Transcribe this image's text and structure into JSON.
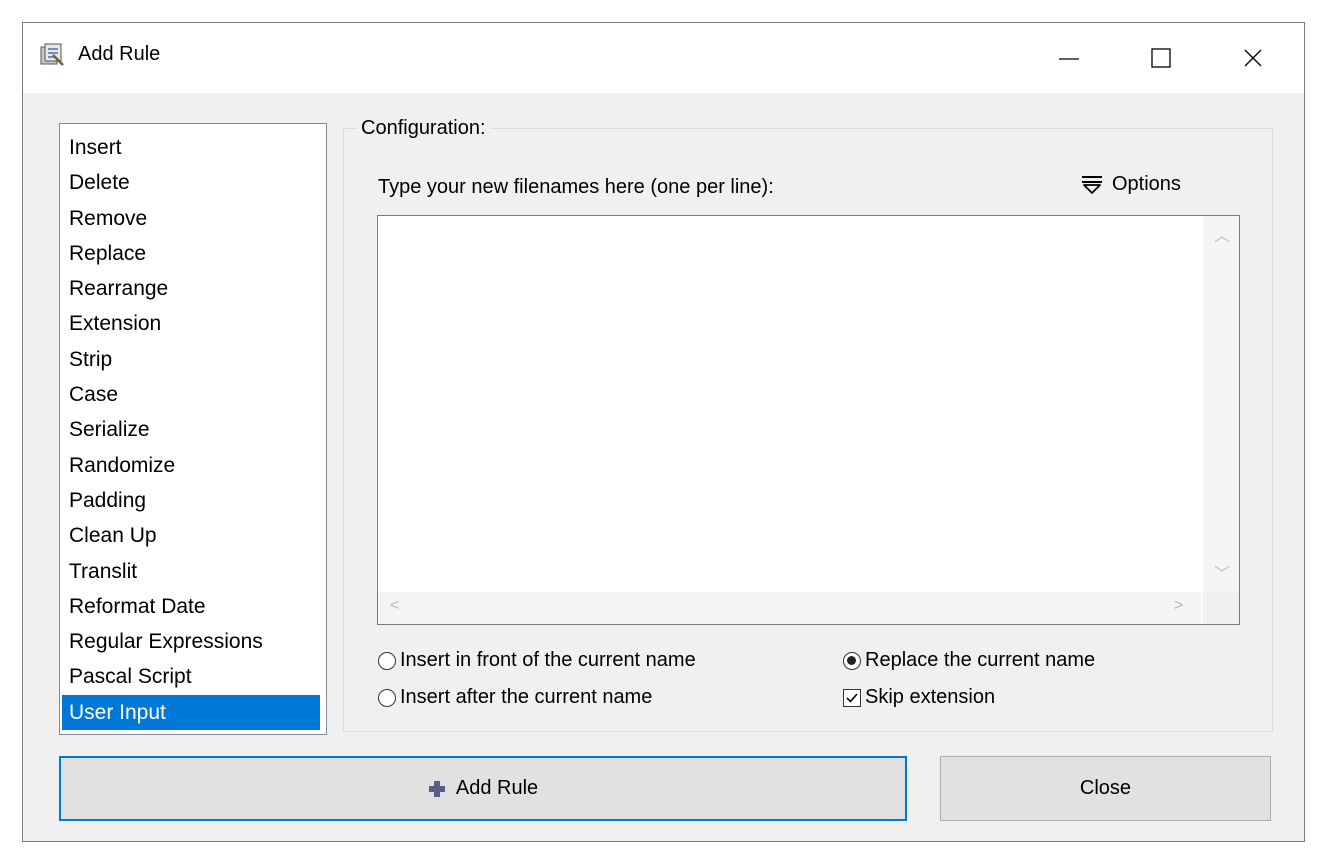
{
  "window": {
    "title": "Add Rule"
  },
  "rules_list": {
    "items": [
      "Insert",
      "Delete",
      "Remove",
      "Replace",
      "Rearrange",
      "Extension",
      "Strip",
      "Case",
      "Serialize",
      "Randomize",
      "Padding",
      "Clean Up",
      "Translit",
      "Reformat Date",
      "Regular Expressions",
      "Pascal Script",
      "User Input"
    ],
    "selected": "User Input"
  },
  "configuration": {
    "legend": "Configuration:",
    "prompt": "Type your new filenames here (one per line):",
    "options_label": "Options",
    "text_value": "",
    "radio_insert_front": "Insert in front of the current name",
    "radio_insert_after": "Insert after the current name",
    "radio_replace": "Replace the current name",
    "selected_mode": "Replace the current name",
    "checkbox_skip_extension": "Skip extension",
    "skip_extension_checked": true
  },
  "buttons": {
    "add_rule": "Add Rule",
    "close": "Close"
  },
  "colors": {
    "selection": "#0078d7",
    "plus_icon": "#5b5b8f"
  }
}
